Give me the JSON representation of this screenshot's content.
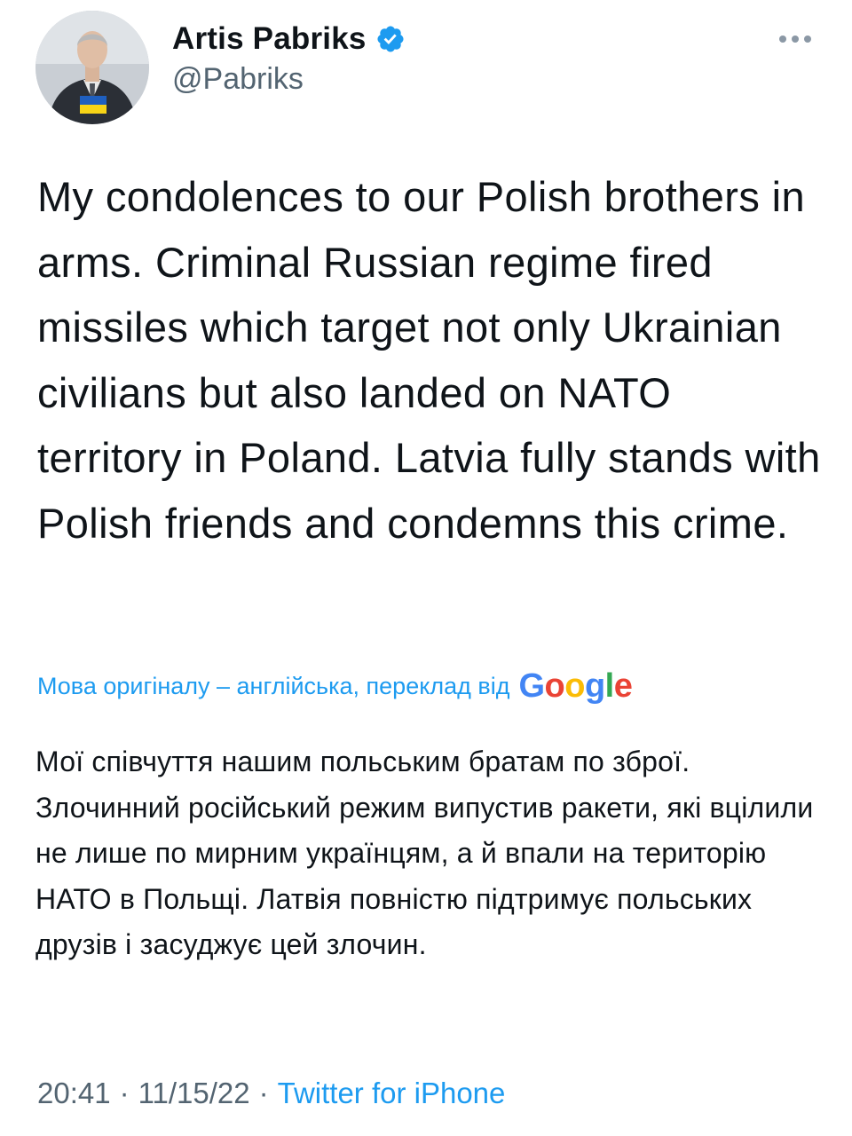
{
  "author": {
    "display_name": "Artis Pabriks",
    "handle": "@Pabriks",
    "verified": true,
    "avatar_icon": "avatar-photo-with-ukraine-flag"
  },
  "more_icon": "more-horizontal-icon",
  "tweet": {
    "text": "My condolences to our Polish brothers in arms. Criminal Russian regime fired missiles which target not only Ukrainian civilians but also landed on NATO territory in Poland. Latvia fully stands with Polish friends and condemns this crime."
  },
  "translation": {
    "label": "Мова оригіналу – англійська, переклад від",
    "provider": "Google",
    "text": "Мої співчуття нашим польським братам по зброї. Злочинний російський режим випустив ракети, які вцілили не лише по мирним українцям, а й впали на територію НАТО в Польщі. Латвія повністю підтримує польських друзів і засуджує цей злочин."
  },
  "meta": {
    "time": "20:41",
    "date": "11/15/22",
    "separator": "·",
    "source": "Twitter for iPhone"
  },
  "colors": {
    "accent": "#1d9bf0",
    "secondary_text": "#536471",
    "primary_text": "#0f1419"
  }
}
